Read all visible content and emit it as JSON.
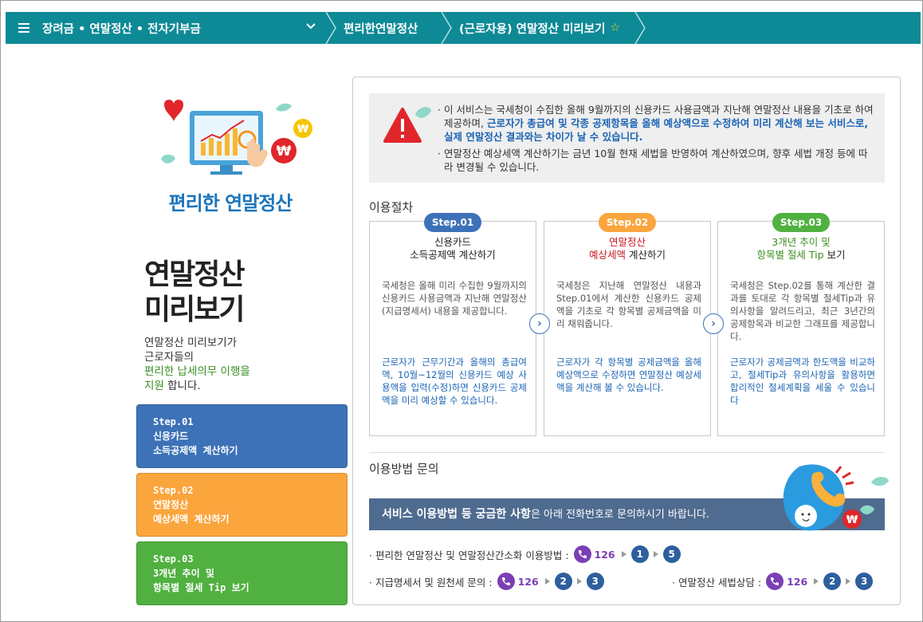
{
  "topbar": {
    "menu1": "장려금 • 연말정산 • 전자기부금",
    "menu2": "편리한연말정산",
    "menu3": "(근로자용) 연말정산 미리보기"
  },
  "left": {
    "hero_title": "편리한 연말정산",
    "big_title_1": "연말정산",
    "big_title_2": "미리보기",
    "desc_1": "연말정산 미리보기가",
    "desc_2": "근로자들의",
    "desc_3_green": "편리한 납세의무 이행을",
    "desc_4_green": "지원",
    "desc_4_rest": " 합니다.",
    "steps": [
      {
        "l1": "Step.01",
        "l2": "신용카드",
        "l3": "소득공제액 계산하기"
      },
      {
        "l1": "Step.02",
        "l2": "연말정산",
        "l3": "예상세액 계산하기"
      },
      {
        "l1": "Step.03",
        "l2": "3개년 추이 및",
        "l3": "항목별 절세 Tip 보기"
      }
    ]
  },
  "notice": {
    "p1_a": "· 이 서비스는 국세청이 수집한 올해 9월까지의 신용카드 사용금액과 지난해 연말정산 내용을 기초로 하여 제공하며, ",
    "p1_b": "근로자가 총급여 및 각종 공제항목을 올해 예상액으로 수정하여 미리 계산해 보는 서비스로, 실제 연말정산 결과와는 차이가 날 수 있습니다.",
    "p2": "· 연말정산 예상세액 계산하기는 금년 10월 현재 세법을 반영하여 계산하였으며, 향후 세법 개정 등에 따라 변경될 수 있습니다."
  },
  "procedure": {
    "title": "이용절차",
    "cards": [
      {
        "pill": "Step.01",
        "t1": "신용카드",
        "t2": "소득공제액 계산하기",
        "p1": "국세청은 올해 미리 수집한 9월까지의 신용카드 사용금액과 지난해 연말정산(지급명세서) 내용을 제공합니다.",
        "p2": "근로자가 근무기간과 올해의 총급여액, 10월~12월의 신용카드 예상 사용액을 입력(수정)하면 신용카드 공제액을 미리 예상할 수 있습니다."
      },
      {
        "pill": "Step.02",
        "t1": "연말정산",
        "t2a": "예상세액",
        "t2b": " 계산하기",
        "p1": "국세청은 지난해 연말정산 내용과 Step.01에서 계산한 신용카드 공제액을 기초로 각 항목별 공제금액을 미리 채워줍니다.",
        "p2": "근로자가 각 항목별 공제금액을 올해예상액으로 수정하면 연말정산 예상세액을 계산해 볼 수 있습니다."
      },
      {
        "pill": "Step.03",
        "t1": "3개년 추이 및",
        "t2a": "항목별 절세 Tip",
        "t2b": " 보기",
        "p1": "국세청은 Step.02를 통해 계산한 결과를 토대로 각 항목별 절세Tip과 유의사항을 알려드리고, 최근 3년간의 공제항목과 비교한 그래프를 제공합니다.",
        "p2": "근로자가 공제금액과 한도액을 비교하고, 절세Tip과 유의사항을 활용하면 합리적인 절세계획을 세울 수 있습니다"
      }
    ]
  },
  "inquiry": {
    "title": "이용방법 문의",
    "banner_bold": "서비스 이용방법 등 궁금한 사항",
    "banner_rest": "은 아래 전화번호로 문의하시기 바랍니다.",
    "c1_label": "· 편리한 연말정산 및 연말정산간소화 이용방법 :",
    "c1_num": "126",
    "c1_a": "1",
    "c1_b": "5",
    "c2_label": "· 지급명세서  및 원천세 문의 :",
    "c2_num": "126",
    "c2_a": "2",
    "c2_b": "3",
    "c3_label": "· 연말정산  세법상담  :",
    "c3_num": "126",
    "c3_a": "2",
    "c3_b": "3"
  },
  "colors": {
    "topbar": "#0e8a96",
    "step1": "#3d72b8",
    "step2": "#fba53d",
    "step3": "#50b040",
    "accent_blue": "#1c64b4",
    "phone": "#7b3fb5"
  }
}
